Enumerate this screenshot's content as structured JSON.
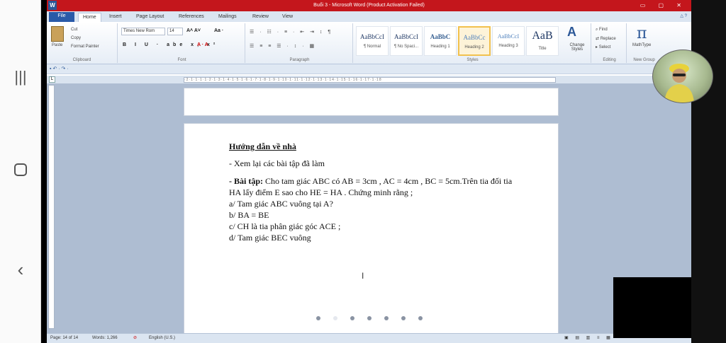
{
  "window": {
    "title": "Buổi 3 - Microsoft Word (Product Activation Failed)",
    "app_letter": "W"
  },
  "tabs": [
    "File",
    "Home",
    "Insert",
    "Page Layout",
    "References",
    "Mailings",
    "Review",
    "View"
  ],
  "ribbon": {
    "clipboard": {
      "paste": "Paste",
      "cut": "Cut",
      "copy": "Copy",
      "format_painter": "Format Painter",
      "label": "Clipboard"
    },
    "font": {
      "name": "Times New Rom",
      "size": "14",
      "label": "Font"
    },
    "paragraph": {
      "label": "Paragraph"
    },
    "styles": {
      "items": [
        {
          "sample": "AaBbCcI",
          "name": "¶ Normal"
        },
        {
          "sample": "AaBbCcI",
          "name": "¶ No Spaci..."
        },
        {
          "sample": "AaBbC",
          "name": "Heading 1"
        },
        {
          "sample": "AaBbCc",
          "name": "Heading 2"
        },
        {
          "sample": "AaBbCcI",
          "name": "Heading 3"
        },
        {
          "sample": "AaB",
          "name": "Title"
        }
      ],
      "change_styles": "Change Styles",
      "label": "Styles"
    },
    "editing": {
      "find": "Find",
      "replace": "Replace",
      "select": "Select",
      "label": "Editing"
    },
    "new_group": {
      "label": "New Group",
      "mathtype": "MathType"
    }
  },
  "document": {
    "heading": "Hướng dẫn về nhà",
    "item1": "- Xem lại các bài tập đã làm",
    "exercise_label": "- Bài tập:",
    "exercise_text": " Cho tam giác ABC có AB = 3cm , AC = 4cm , BC = 5cm.Trên tia đối tia",
    "exercise_line2": "HA lấy điểm E sao cho HE = HA . Chứng minh rằng ;",
    "a": "a/ Tam giác ABC vuông tại A?",
    "b": "b/ BA = BE",
    "c": "c/ CH là tia phân giác góc ACE ;",
    "d": "d/ Tam giác BEC vuông"
  },
  "status": {
    "page": "Page: 14 of 14",
    "words": "Words: 1,266",
    "language": "English (U.S.)"
  }
}
